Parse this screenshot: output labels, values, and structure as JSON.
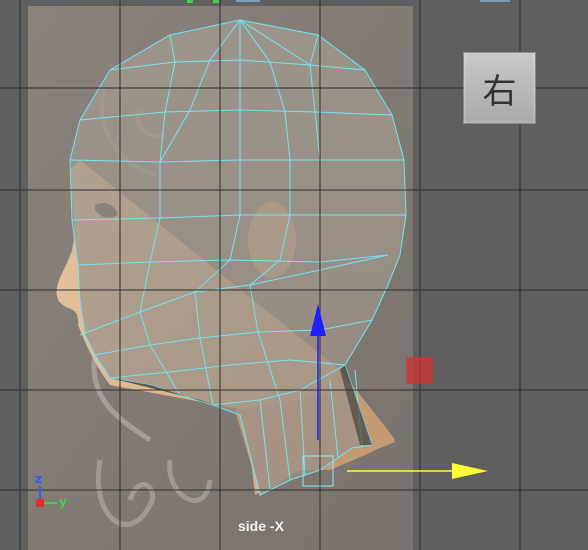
{
  "viewport": {
    "view_label": "side -X",
    "view_cube_label": "右",
    "colors": {
      "background": "#5f5f5f",
      "grid": "#2e2e2e",
      "wireframe": "#6fe6f2",
      "move_y_axis": "#1f1fff",
      "move_z_axis": "#ffff33",
      "scale_handle": "#d03434"
    }
  },
  "axis_indicator": {
    "z_label": "z",
    "y_label": "y",
    "z_color": "#2c5cff",
    "y_color": "#46d046",
    "x_color": "#e03030"
  },
  "gizmo": {
    "up_axis_icon": "arrow-up-icon",
    "right_axis_icon": "arrow-right-icon",
    "center_handle_icon": "square-handle-icon",
    "scale_handle_icon": "red-square-icon"
  }
}
